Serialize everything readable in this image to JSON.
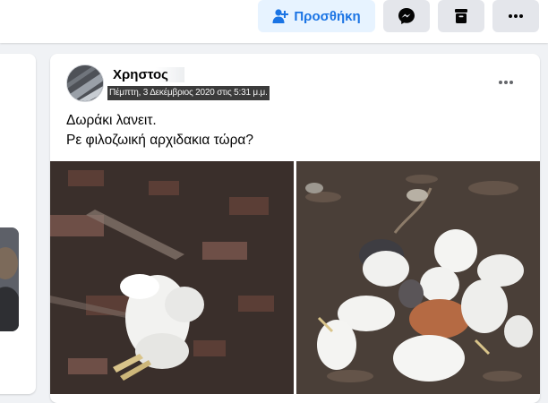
{
  "topbar": {
    "add_label": "Προσθήκη",
    "add_icon": "add-friend-icon",
    "messenger_icon": "messenger-icon",
    "archive_icon": "archive-icon",
    "more_icon": "more-dots-icon",
    "accent": "#1b74e4",
    "add_bg": "#e7f3ff"
  },
  "post": {
    "author": "Χρηστος",
    "timestamp": "Πέμπτη, 3 Δεκέμβριος 2020 στις 5:31 μ.μ.",
    "caption_lines": [
      "Δωράκι λανειτ.",
      "Ρε φιλοζωική αρχιδακια τώρα?"
    ],
    "more_icon": "more-dots-icon",
    "photos": [
      "photo-left",
      "photo-right"
    ]
  }
}
